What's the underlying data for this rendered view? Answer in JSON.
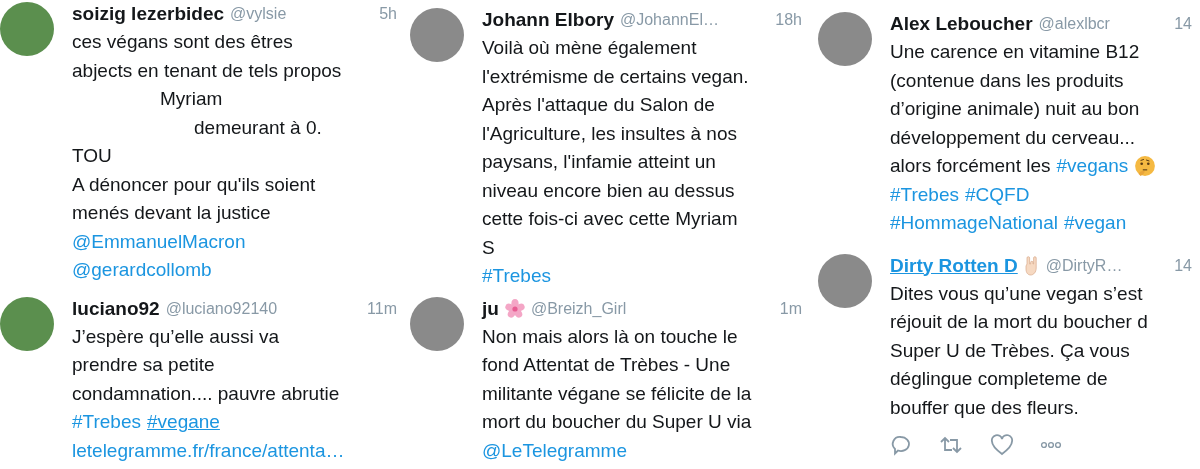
{
  "columns": [
    {
      "tweets": [
        {
          "name": "soizig lezerbidec",
          "name_hovered": false,
          "handle": "@vylsie",
          "time": "5h",
          "avatar": {
            "kind": "cartoon"
          },
          "actions": false,
          "lines": [
            [
              {
                "kind": "text",
                "text": "ces végans sont des êtres"
              }
            ],
            [
              {
                "kind": "text",
                "text": "abjects en tenant de tels propos"
              }
            ],
            [
              {
                "kind": "redacted",
                "text": "Myriam"
              }
            ],
            [
              {
                "kind": "redacted-far",
                "text": "demeurant à 0."
              }
            ],
            [
              {
                "kind": "text",
                "text": "TOU"
              }
            ],
            [
              {
                "kind": "text",
                "text": "A dénoncer pour qu'ils soient"
              }
            ],
            [
              {
                "kind": "text",
                "text": "menés devant la justice"
              }
            ],
            [
              {
                "kind": "mention",
                "text": "@EmmanuelMacron",
                "underlined": false
              }
            ],
            [
              {
                "kind": "mention",
                "text": "@gerardcollomb",
                "underlined": false
              }
            ]
          ]
        },
        {
          "name": "luciano92",
          "name_hovered": false,
          "handle": "@luciano92140",
          "time": "11m",
          "avatar": {
            "kind": "cartoon"
          },
          "actions": false,
          "lines": [
            [
              {
                "kind": "text",
                "text": "J’espère qu’elle aussi va"
              }
            ],
            [
              {
                "kind": "text",
                "text": "prendre sa petite"
              }
            ],
            [
              {
                "kind": "text",
                "text": "condamnation.... pauvre abrutie"
              }
            ],
            [
              {
                "kind": "hashtag",
                "text": "#Trebes",
                "underlined": false
              },
              {
                "kind": "hashtag",
                "text": "#vegane",
                "underlined": true
              }
            ],
            [
              {
                "kind": "url",
                "text": "letelegramme.fr/france/attenta…",
                "underlined": false
              }
            ]
          ]
        }
      ]
    },
    {
      "tweets": [
        {
          "name": "Johann Elbory",
          "name_hovered": false,
          "handle": "@JohannEl…",
          "time": "18h",
          "avatar": {
            "kind": "photo"
          },
          "actions": false,
          "lines": [
            [
              {
                "kind": "text",
                "text": "Voilà où mène également"
              }
            ],
            [
              {
                "kind": "text",
                "text": "l'extrémisme de certains vegan."
              }
            ],
            [
              {
                "kind": "text",
                "text": "Après l'attaque du Salon de"
              }
            ],
            [
              {
                "kind": "text",
                "text": "l'Agriculture, les insultes à nos"
              }
            ],
            [
              {
                "kind": "text",
                "text": "paysans, l'infamie atteint un"
              }
            ],
            [
              {
                "kind": "text",
                "text": "niveau encore bien au dessus"
              }
            ],
            [
              {
                "kind": "text",
                "text": "cette fois-ci avec cette Myriam"
              }
            ],
            [
              {
                "kind": "text",
                "text": "S"
              }
            ],
            [
              {
                "kind": "hashtag",
                "text": "#Trebes",
                "underlined": false
              }
            ]
          ]
        },
        {
          "name": "ju",
          "name_badge": {
            "kind": "flower"
          },
          "name_hovered": false,
          "handle": "@Breizh_Girl",
          "time": "1m",
          "avatar": {
            "kind": "photo"
          },
          "actions": false,
          "lines": [
            [
              {
                "kind": "text",
                "text": "Non mais alors là on touche le"
              }
            ],
            [
              {
                "kind": "text",
                "text": "fond Attentat de Trèbes - Une"
              }
            ],
            [
              {
                "kind": "text",
                "text": "militante végane se félicite de la"
              }
            ],
            [
              {
                "kind": "text",
                "text": "mort du boucher du Super U via"
              }
            ],
            [
              {
                "kind": "mention",
                "text": "@LeTelegramme",
                "underlined": false
              }
            ]
          ]
        }
      ]
    },
    {
      "tweets": [
        {
          "name": "Alex Leboucher",
          "name_hovered": false,
          "handle": "@alexlbcr",
          "time": "14",
          "avatar": {
            "kind": "photo"
          },
          "actions": false,
          "lines": [
            [
              {
                "kind": "text",
                "text": "Une carence en vitamine B12"
              }
            ],
            [
              {
                "kind": "text",
                "text": "(contenue dans les produits"
              }
            ],
            [
              {
                "kind": "text",
                "text": "d’origine animale) nuit au bon"
              }
            ],
            [
              {
                "kind": "text",
                "text": "développement du cerveau..."
              }
            ],
            [
              {
                "kind": "text",
                "text": "alors forcément les"
              },
              {
                "kind": "hashtag",
                "text": "#vegans",
                "underlined": false
              },
              {
                "kind": "emoji"
              }
            ],
            [
              {
                "kind": "hashtag",
                "text": "#Trebes",
                "underlined": false
              },
              {
                "kind": "hashtag",
                "text": "#CQFD",
                "underlined": false
              }
            ],
            [
              {
                "kind": "hashtag",
                "text": "#HommageNational",
                "underlined": false
              },
              {
                "kind": "hashtag",
                "text": "#vegan",
                "underlined": false
              }
            ]
          ]
        },
        {
          "name": "Dirty Rotten D",
          "name_badge": {
            "kind": "hand"
          },
          "name_hovered": true,
          "handle": "@DirtyR…",
          "time": "14",
          "avatar": {
            "kind": "photo"
          },
          "actions": true,
          "lines": [
            [
              {
                "kind": "text",
                "text": "Dites vous qu’une vegan s’est"
              }
            ],
            [
              {
                "kind": "text",
                "text": "réjouit de la mort du boucher d"
              }
            ],
            [
              {
                "kind": "text",
                "text": "Super U de Trèbes. Ça vous"
              }
            ],
            [
              {
                "kind": "text",
                "text": "déglingue completeme de"
              }
            ],
            [
              {
                "kind": "text",
                "text": "bouffer que des fleurs."
              }
            ]
          ]
        }
      ]
    }
  ]
}
